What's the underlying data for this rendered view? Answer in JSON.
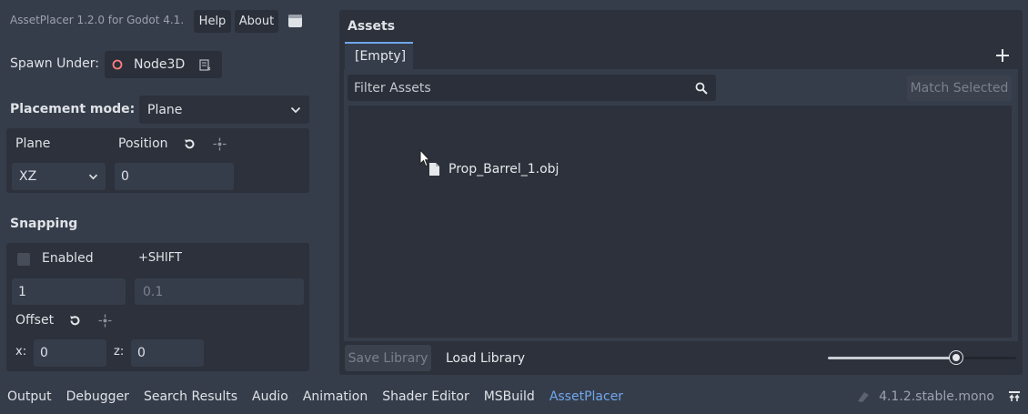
{
  "plugin": {
    "title": "AssetPlacer 1.2.0 for Godot 4.1.",
    "help_label": "Help",
    "about_label": "About"
  },
  "spawn": {
    "label": "Spawn Under:",
    "node_name": "Node3D"
  },
  "placement": {
    "label": "Placement mode:",
    "mode": "Plane",
    "plane_label": "Plane",
    "position_label": "Position",
    "plane_value": "XZ",
    "position_value": "0"
  },
  "snapping": {
    "title": "Snapping",
    "enabled_label": "Enabled",
    "shift_label": "+SHIFT",
    "step_value": "1",
    "shift_placeholder": "0.1",
    "offset_label": "Offset",
    "x_label": "x:",
    "x_value": "0",
    "z_label": "z:",
    "z_value": "0"
  },
  "assets": {
    "title": "Assets",
    "tab_label": "[Empty]",
    "filter_placeholder": "Filter Assets",
    "match_selected_label": "Match Selected",
    "items": [
      {
        "name": "Prop_Barrel_1.obj"
      }
    ],
    "save_library_label": "Save Library",
    "load_library_label": "Load Library",
    "zoom_level": 0.68
  },
  "bottom_tabs": [
    {
      "label": "Output"
    },
    {
      "label": "Debugger"
    },
    {
      "label": "Search Results"
    },
    {
      "label": "Audio"
    },
    {
      "label": "Animation"
    },
    {
      "label": "Shader Editor"
    },
    {
      "label": "MSBuild"
    },
    {
      "label": "AssetPlacer",
      "active": true
    }
  ],
  "status": {
    "version": "4.1.2.stable.mono"
  },
  "colors": {
    "accent": "#6fa7ec",
    "node_icon": "#fc7f7f"
  }
}
